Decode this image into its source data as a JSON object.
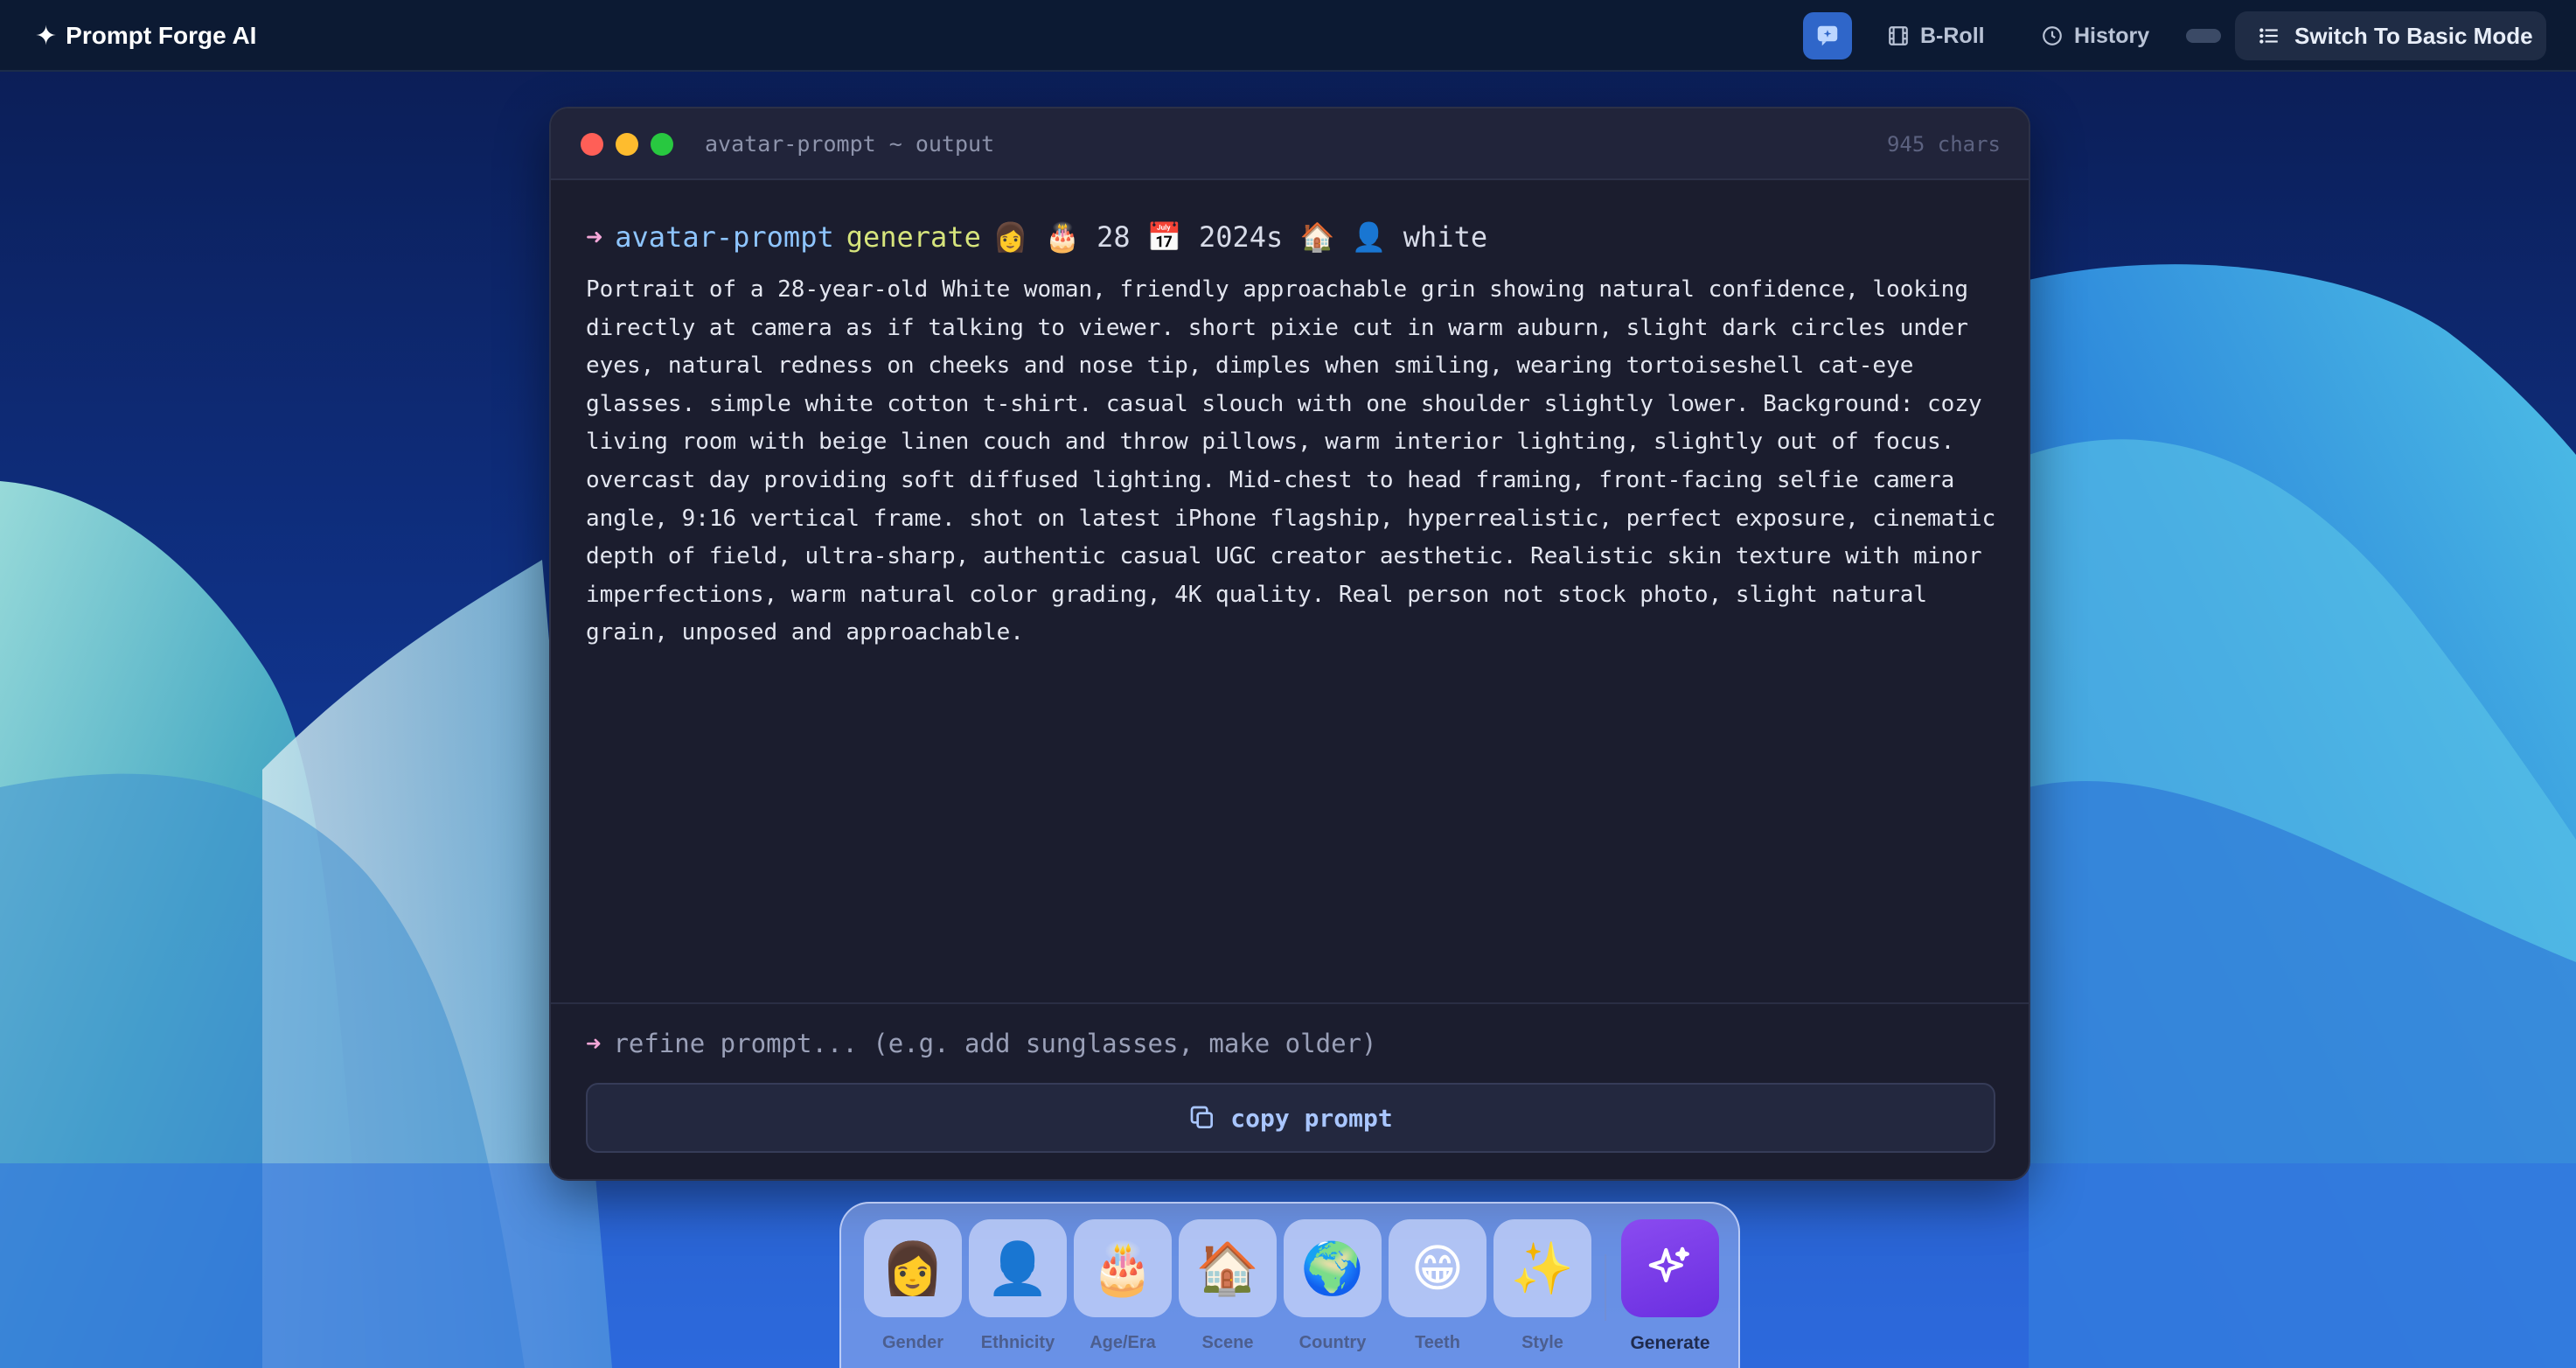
{
  "app": {
    "brand": "Prompt Forge AI"
  },
  "topbar": {
    "b_roll": "B-Roll",
    "history": "History",
    "mode_button": "Switch To Basic Mode"
  },
  "terminal": {
    "title": "avatar-prompt ~ output",
    "char_count": "945 chars",
    "command": {
      "arrow": "➜",
      "program": "avatar-prompt",
      "verb": "generate",
      "args": "👩 🎂 28 📅 2024s 🏠 👤 white"
    },
    "prompt_text": "Portrait of a 28-year-old White woman, friendly approachable grin showing natural confidence, looking directly at camera as if talking to viewer. short pixie cut in warm auburn, slight dark circles under eyes, natural redness on cheeks and nose tip, dimples when smiling, wearing tortoiseshell cat-eye glasses. simple white cotton t-shirt. casual slouch with one shoulder slightly lower. Background: cozy living room with beige linen couch and throw pillows, warm interior lighting, slightly out of focus. overcast day providing soft diffused lighting. Mid-chest to head framing, front-facing selfie camera angle, 9:16 vertical frame. shot on latest iPhone flagship, hyperrealistic, perfect exposure, cinematic depth of field, ultra-sharp, authentic casual UGC creator aesthetic. Realistic skin texture with minor imperfections, warm natural color grading, 4K quality. Real person not stock photo, slight natural grain, unposed and approachable.",
    "refine_arrow": "➜",
    "refine_placeholder": "refine prompt... (e.g. add sunglasses, make older)",
    "refine_value": "",
    "copy_label": "copy prompt"
  },
  "dock": {
    "items": [
      {
        "emoji": "👩",
        "label": "Gender"
      },
      {
        "emoji": "👤",
        "label": "Ethnicity"
      },
      {
        "emoji": "🎂",
        "label": "Age/Era"
      },
      {
        "emoji": "🏠",
        "label": "Scene"
      },
      {
        "emoji": "🌍",
        "label": "Country"
      },
      {
        "emoji": "😁",
        "label": "Teeth"
      },
      {
        "emoji": "✨",
        "label": "Style"
      }
    ],
    "generate_label": "Generate"
  },
  "colors": {
    "accent_blue": "#2f66c9",
    "generate_purple": "#7b3df0",
    "terminal_bg": "#1b1d2e",
    "prompt_arrow": "#f4a6d7",
    "program_color": "#8ec5ff",
    "verb_color": "#d6e47c"
  },
  "icons": {
    "chat": "chat-bubble-icon",
    "b_roll": "film-icon",
    "history": "clock-icon",
    "mode": "list-icon",
    "copy": "copy-icon",
    "generate": "sparkle-icon"
  }
}
